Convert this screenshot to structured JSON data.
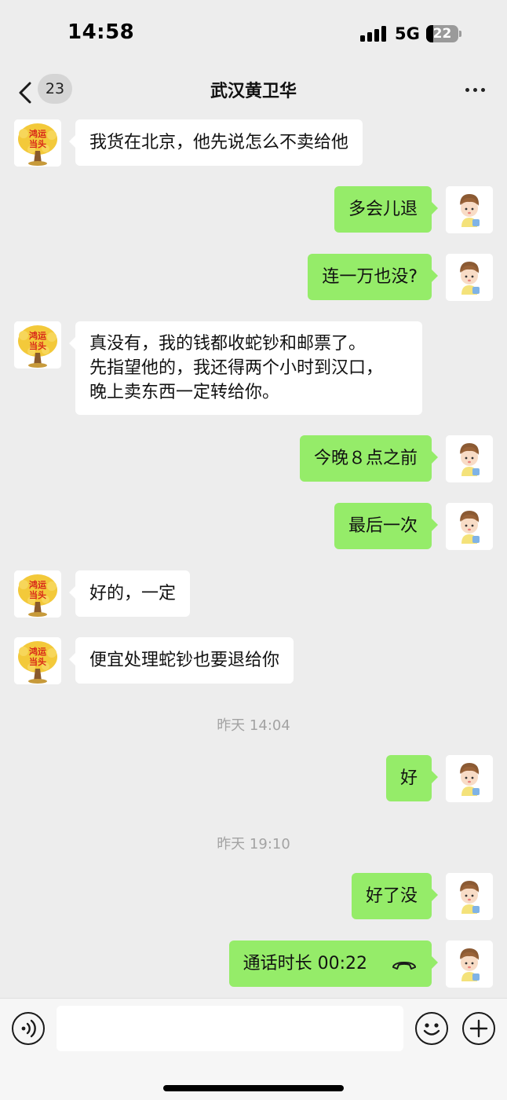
{
  "status_bar": {
    "time": "14:58",
    "network": "5G",
    "battery": "22"
  },
  "nav": {
    "unread_count": "23",
    "title": "武汉黄卫华"
  },
  "avatars": {
    "contact_text": "鸿运当头"
  },
  "messages": [
    {
      "side": "in",
      "text": "我货在北京，他先说怎么不卖给他"
    },
    {
      "side": "out",
      "text": "多会儿退"
    },
    {
      "side": "out",
      "text": "连一万也没?"
    },
    {
      "side": "in",
      "lines": [
        "真没有，我的钱都收蛇钞和邮票了。",
        "先指望他的，我还得两个小时到汉口，",
        "晚上卖东西一定转给你。"
      ]
    },
    {
      "side": "out",
      "text": "今晚８点之前"
    },
    {
      "side": "out",
      "text": "最后一次"
    },
    {
      "side": "in",
      "text": "好的，一定"
    },
    {
      "side": "in",
      "text": "便宜处理蛇钞也要退给你"
    },
    {
      "type": "timestamp",
      "text": "昨天 14:04"
    },
    {
      "side": "out",
      "text": "好"
    },
    {
      "type": "timestamp",
      "text": "昨天 19:10"
    },
    {
      "side": "out",
      "text": "好了没"
    },
    {
      "side": "out",
      "type": "call",
      "text": "通话时长 00:22"
    }
  ],
  "colors": {
    "background": "#ededed",
    "outgoing_bubble": "#95ec69",
    "incoming_bubble": "#ffffff"
  },
  "icons": [
    "back-chevron-icon",
    "more-dots-icon",
    "voice-icon",
    "emoji-icon",
    "plus-icon",
    "phone-icon"
  ]
}
